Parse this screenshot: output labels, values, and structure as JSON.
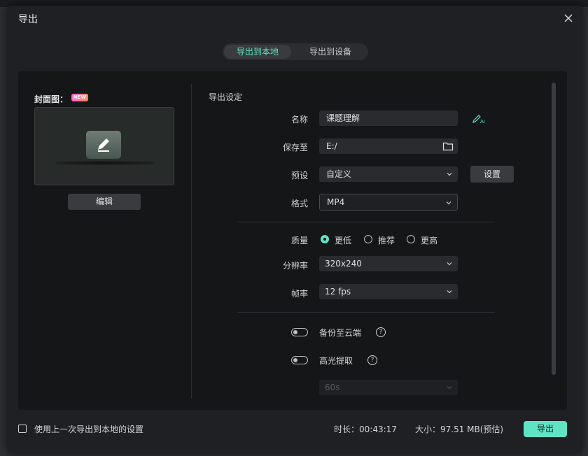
{
  "dialog": {
    "title": "导出",
    "tabs": [
      {
        "label": "导出到本地",
        "active": true
      },
      {
        "label": "导出到设备",
        "active": false
      }
    ]
  },
  "cover": {
    "label": "封面图：",
    "badge": "NEW",
    "edit_label": "编辑"
  },
  "settings": {
    "title": "导出设定",
    "name": {
      "label": "名称",
      "value": "课题理解"
    },
    "save_to": {
      "label": "保存至",
      "value": "E:/"
    },
    "preset": {
      "label": "预设",
      "value": "自定义",
      "button": "设置"
    },
    "format": {
      "label": "格式",
      "value": "MP4"
    },
    "quality": {
      "label": "质量",
      "options": [
        {
          "label": "更低",
          "checked": true
        },
        {
          "label": "推荐",
          "checked": false
        },
        {
          "label": "更高",
          "checked": false
        }
      ]
    },
    "resolution": {
      "label": "分辨率",
      "value": "320x240"
    },
    "framerate": {
      "label": "帧率",
      "value": "12 fps"
    },
    "backup": {
      "label": "备份至云端",
      "on": false
    },
    "highlight": {
      "label": "高光提取",
      "on": false,
      "duration_value": "60s"
    }
  },
  "footer": {
    "use_last_label": "使用上一次导出到本地的设置",
    "duration": "时长：00:43:17",
    "size": "大小：97.51 MB(预估)",
    "export_label": "导出"
  },
  "colors": {
    "accent": "#5fe3c5",
    "panel": "#151618",
    "dialog": "#1f2023"
  }
}
